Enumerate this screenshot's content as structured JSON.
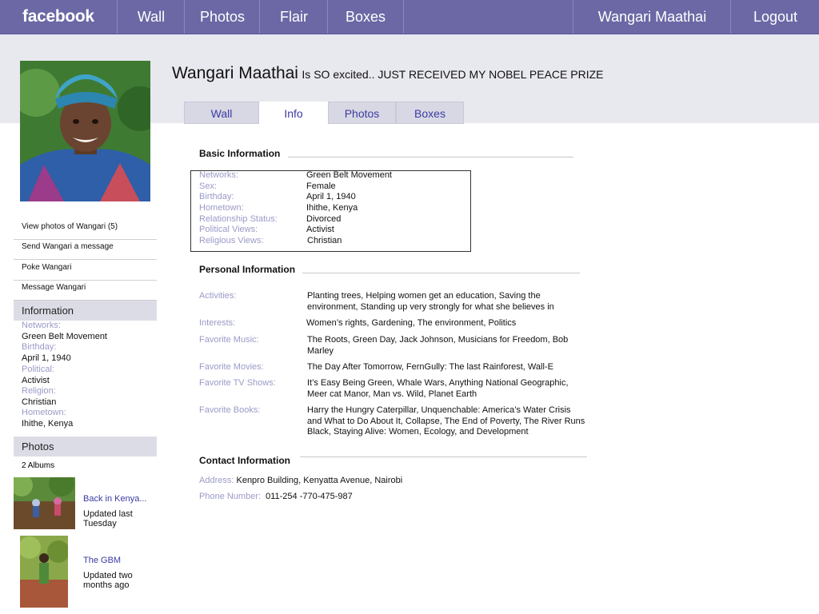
{
  "nav": {
    "logo": "facebook",
    "items": [
      "Wall",
      "Photos",
      "Flair",
      "Boxes"
    ],
    "user": "Wangari Maathai",
    "logout": "Logout"
  },
  "profile": {
    "name": "Wangari Maathai",
    "status": "Is SO excited.. JUST RECEIVED MY NOBEL PEACE PRIZE"
  },
  "tabs": [
    "Wall",
    "Info",
    "Photos",
    "Boxes"
  ],
  "active_tab": "Info",
  "sidebar": {
    "links": [
      "View photos of Wangari (5)",
      "Send Wangari a message",
      "Poke Wangari",
      "Message Wangari"
    ],
    "info_heading": "Information",
    "info": [
      {
        "label": "Networks:",
        "value": "Green Belt Movement"
      },
      {
        "label": "Birthday:",
        "value": "April 1, 1940"
      },
      {
        "label": "Political:",
        "value": "Activist"
      },
      {
        "label": "Religion:",
        "value": "Christian"
      },
      {
        "label": "Hometown:",
        "value": "Ihithe, Kenya"
      }
    ],
    "photos_heading": "Photos",
    "albums_count": "2 Albums",
    "albums": [
      {
        "title": "Back in Kenya...",
        "updated": "Updated last Tuesday"
      },
      {
        "title": "The GBM",
        "updated": "Updated two months ago"
      }
    ]
  },
  "basic": {
    "title": "Basic Information",
    "rows": [
      {
        "label": "Networks:",
        "value": "Green Belt Movement"
      },
      {
        "label": "Sex:",
        "value": "Female"
      },
      {
        "label": "Birthday:",
        "value": "April 1, 1940"
      },
      {
        "label": "Hometown:",
        "value": "Ihithe, Kenya"
      },
      {
        "label": "Relationship Status:",
        "value": "Divorced"
      },
      {
        "label": "Political Views:",
        "value": "Activist"
      },
      {
        "label": "Religious Views:",
        "value": "Christian"
      }
    ]
  },
  "personal": {
    "title": "Personal Information",
    "rows": [
      {
        "label": "Activities:",
        "value": "Planting trees, Helping women get an education, Saving the environment, Standing up very strongly for what she believes in"
      },
      {
        "label": "Interests:",
        "value": "Women’s rights, Gardening, The environment, Politics"
      },
      {
        "label": "Favorite Music:",
        "value": "The Roots, Green Day, Jack Johnson, Musicians for Freedom, Bob Marley"
      },
      {
        "label": "Favorite Movies:",
        "value": "The Day After Tomorrow, FernGully: The last Rainforest, Wall-E"
      },
      {
        "label": "Favorite TV Shows:",
        "value": "It’s Easy Being Green, Whale Wars, Anything National Geographic, Meer cat Manor, Man vs. Wild, Planet Earth"
      },
      {
        "label": "Favorite Books:",
        "value": "Harry the Hungry Caterpillar, Unquenchable: America’s Water Crisis and What to Do About It, Collapse, The End of Poverty, The River Runs Black, Staying Alive: Women, Ecology, and Development"
      }
    ]
  },
  "contact": {
    "title": "Contact Information",
    "address_label": "Address:",
    "address": "Kenpro Building, Kenyatta Avenue, Nairobi",
    "phone_label": "Phone Number:",
    "phone": "011-254 -770-475-987"
  },
  "colors": {
    "nav_bg": "#6b68a5",
    "header_band": "#e8e8ef",
    "label": "#9a9ac8",
    "link": "#3b3aa3"
  }
}
